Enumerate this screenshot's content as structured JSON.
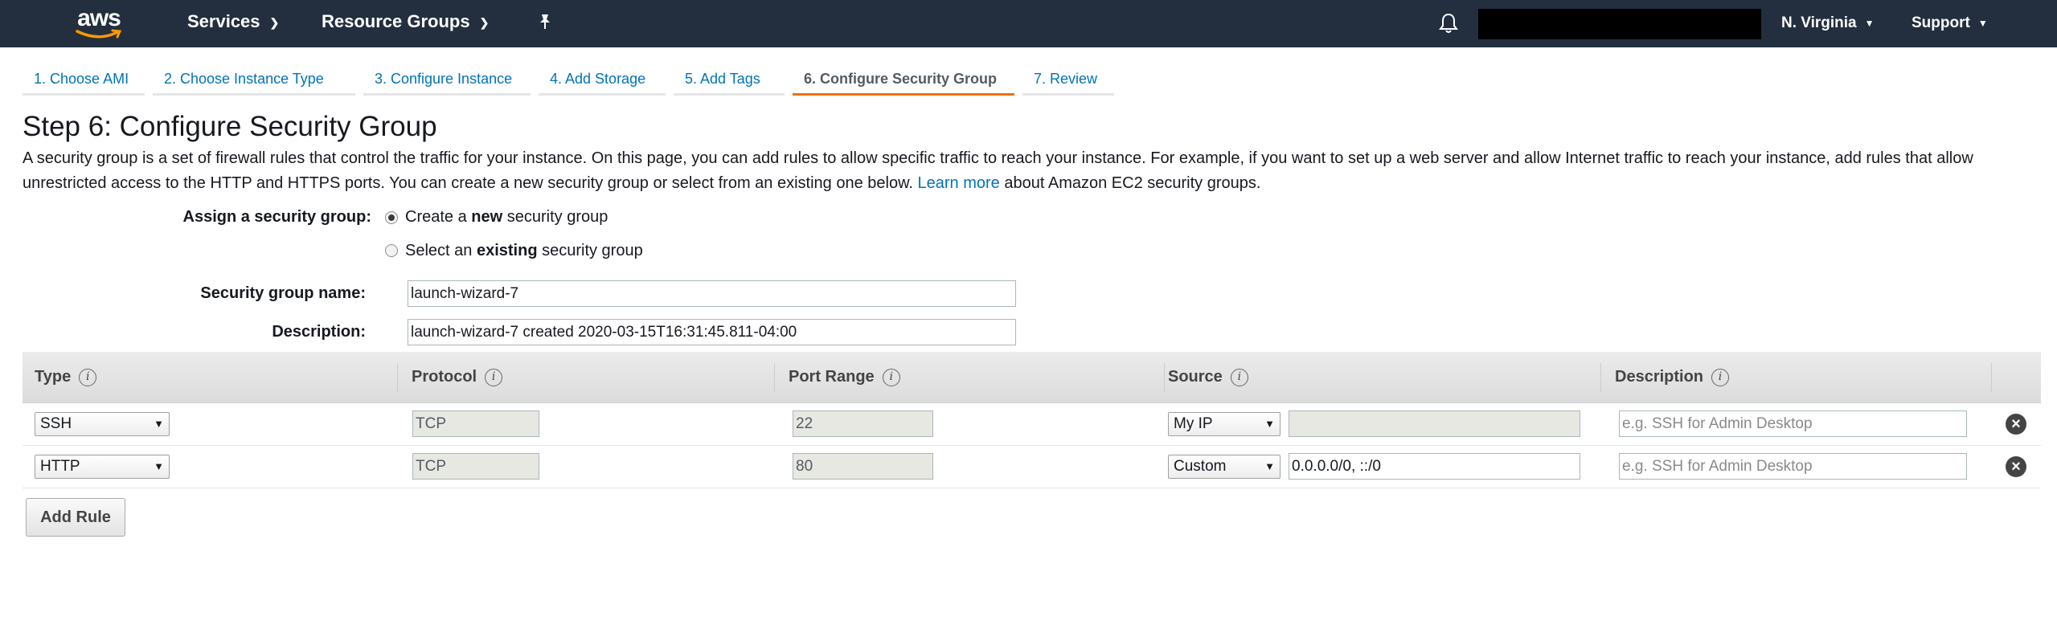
{
  "topnav": {
    "logo_text": "aws",
    "services": "Services",
    "resource_groups": "Resource Groups",
    "region": "N. Virginia",
    "support": "Support"
  },
  "tabs": [
    {
      "label": "1. Choose AMI"
    },
    {
      "label": "2. Choose Instance Type"
    },
    {
      "label": "3. Configure Instance"
    },
    {
      "label": "4. Add Storage"
    },
    {
      "label": "5. Add Tags"
    },
    {
      "label": "6. Configure Security Group",
      "active": true
    },
    {
      "label": "7. Review"
    }
  ],
  "step_title": "Step 6: Configure Security Group",
  "intro": {
    "text": "A security group is a set of firewall rules that control the traffic for your instance. On this page, you can add rules to allow specific traffic to reach your instance. For example, if you want to set up a web server and allow Internet traffic to reach your instance, add rules that allow unrestricted access to the HTTP and HTTPS ports. You can create a new security group or select from an existing one below.",
    "learn_more": "Learn more",
    "suffix": "about Amazon EC2 security groups."
  },
  "assign": {
    "label": "Assign a security group:",
    "option_new_pre": "Create a",
    "option_new_bold": "new",
    "option_new_post": "security group",
    "option_existing_pre": "Select an",
    "option_existing_bold": "existing",
    "option_existing_post": "security group",
    "selected": "new"
  },
  "sg_name": {
    "label": "Security group name:",
    "value": "launch-wizard-7"
  },
  "sg_description": {
    "label": "Description:",
    "value": "launch-wizard-7 created 2020-03-15T16:31:45.811-04:00"
  },
  "table": {
    "headers": [
      "Type",
      "Protocol",
      "Port Range",
      "Source",
      "Description"
    ],
    "rows": [
      {
        "type": "SSH",
        "protocol": "TCP",
        "port": "22",
        "source": "My IP",
        "source_value": "",
        "description_placeholder": "e.g. SSH for Admin Desktop"
      },
      {
        "type": "HTTP",
        "protocol": "TCP",
        "port": "80",
        "source": "Custom",
        "source_value": "0.0.0.0/0, ::/0",
        "description_placeholder": "e.g. SSH for Admin Desktop"
      }
    ]
  },
  "add_rule": "Add Rule",
  "colors": {
    "nav_bg": "#232f3e",
    "link": "#0073bb",
    "active_tab": "#ec7211"
  }
}
